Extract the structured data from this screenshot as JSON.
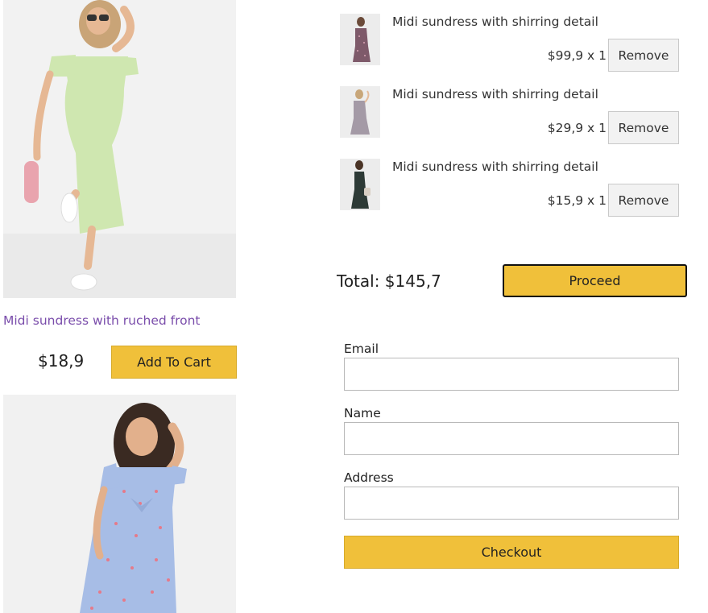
{
  "products": [
    {
      "title": "Midi sundress with ruched front",
      "price": "$18,9",
      "add_label": "Add To Cart",
      "image_icon": "green-sundress-photo"
    },
    {
      "image_icon": "blue-polka-dress-photo"
    }
  ],
  "cart": {
    "items": [
      {
        "title": "Midi sundress with shirring detail",
        "qty_text": "$99,9 x 1",
        "remove_label": "Remove"
      },
      {
        "title": "Midi sundress with shirring detail",
        "qty_text": "$29,9 x 1",
        "remove_label": "Remove"
      },
      {
        "title": "Midi sundress with shirring detail",
        "qty_text": "$15,9 x 1",
        "remove_label": "Remove"
      }
    ],
    "total_text": "Total: $145,7",
    "proceed_label": "Proceed"
  },
  "checkout": {
    "email_label": "Email",
    "name_label": "Name",
    "address_label": "Address",
    "email_value": "",
    "name_value": "",
    "address_value": "",
    "checkout_label": "Checkout"
  },
  "colors": {
    "accent": "#f0c03a",
    "link": "#7a4dab"
  }
}
